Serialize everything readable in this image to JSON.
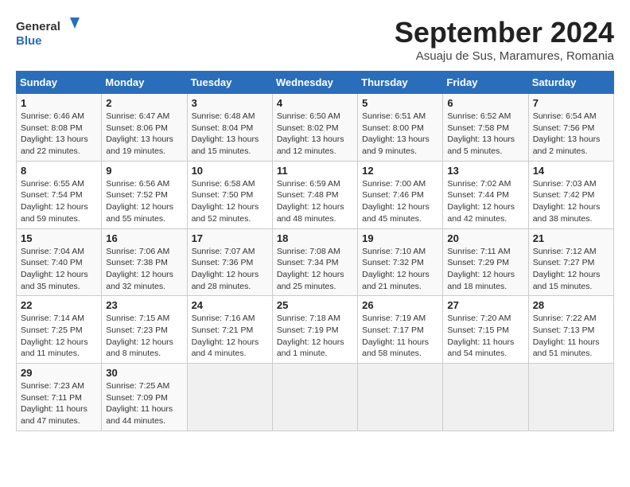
{
  "header": {
    "logo_line1": "General",
    "logo_line2": "Blue",
    "month": "September 2024",
    "location": "Asuaju de Sus, Maramures, Romania"
  },
  "columns": [
    "Sunday",
    "Monday",
    "Tuesday",
    "Wednesday",
    "Thursday",
    "Friday",
    "Saturday"
  ],
  "weeks": [
    [
      {
        "day": "1",
        "detail": "Sunrise: 6:46 AM\nSunset: 8:08 PM\nDaylight: 13 hours\nand 22 minutes."
      },
      {
        "day": "2",
        "detail": "Sunrise: 6:47 AM\nSunset: 8:06 PM\nDaylight: 13 hours\nand 19 minutes."
      },
      {
        "day": "3",
        "detail": "Sunrise: 6:48 AM\nSunset: 8:04 PM\nDaylight: 13 hours\nand 15 minutes."
      },
      {
        "day": "4",
        "detail": "Sunrise: 6:50 AM\nSunset: 8:02 PM\nDaylight: 13 hours\nand 12 minutes."
      },
      {
        "day": "5",
        "detail": "Sunrise: 6:51 AM\nSunset: 8:00 PM\nDaylight: 13 hours\nand 9 minutes."
      },
      {
        "day": "6",
        "detail": "Sunrise: 6:52 AM\nSunset: 7:58 PM\nDaylight: 13 hours\nand 5 minutes."
      },
      {
        "day": "7",
        "detail": "Sunrise: 6:54 AM\nSunset: 7:56 PM\nDaylight: 13 hours\nand 2 minutes."
      }
    ],
    [
      {
        "day": "8",
        "detail": "Sunrise: 6:55 AM\nSunset: 7:54 PM\nDaylight: 12 hours\nand 59 minutes."
      },
      {
        "day": "9",
        "detail": "Sunrise: 6:56 AM\nSunset: 7:52 PM\nDaylight: 12 hours\nand 55 minutes."
      },
      {
        "day": "10",
        "detail": "Sunrise: 6:58 AM\nSunset: 7:50 PM\nDaylight: 12 hours\nand 52 minutes."
      },
      {
        "day": "11",
        "detail": "Sunrise: 6:59 AM\nSunset: 7:48 PM\nDaylight: 12 hours\nand 48 minutes."
      },
      {
        "day": "12",
        "detail": "Sunrise: 7:00 AM\nSunset: 7:46 PM\nDaylight: 12 hours\nand 45 minutes."
      },
      {
        "day": "13",
        "detail": "Sunrise: 7:02 AM\nSunset: 7:44 PM\nDaylight: 12 hours\nand 42 minutes."
      },
      {
        "day": "14",
        "detail": "Sunrise: 7:03 AM\nSunset: 7:42 PM\nDaylight: 12 hours\nand 38 minutes."
      }
    ],
    [
      {
        "day": "15",
        "detail": "Sunrise: 7:04 AM\nSunset: 7:40 PM\nDaylight: 12 hours\nand 35 minutes."
      },
      {
        "day": "16",
        "detail": "Sunrise: 7:06 AM\nSunset: 7:38 PM\nDaylight: 12 hours\nand 32 minutes."
      },
      {
        "day": "17",
        "detail": "Sunrise: 7:07 AM\nSunset: 7:36 PM\nDaylight: 12 hours\nand 28 minutes."
      },
      {
        "day": "18",
        "detail": "Sunrise: 7:08 AM\nSunset: 7:34 PM\nDaylight: 12 hours\nand 25 minutes."
      },
      {
        "day": "19",
        "detail": "Sunrise: 7:10 AM\nSunset: 7:32 PM\nDaylight: 12 hours\nand 21 minutes."
      },
      {
        "day": "20",
        "detail": "Sunrise: 7:11 AM\nSunset: 7:29 PM\nDaylight: 12 hours\nand 18 minutes."
      },
      {
        "day": "21",
        "detail": "Sunrise: 7:12 AM\nSunset: 7:27 PM\nDaylight: 12 hours\nand 15 minutes."
      }
    ],
    [
      {
        "day": "22",
        "detail": "Sunrise: 7:14 AM\nSunset: 7:25 PM\nDaylight: 12 hours\nand 11 minutes."
      },
      {
        "day": "23",
        "detail": "Sunrise: 7:15 AM\nSunset: 7:23 PM\nDaylight: 12 hours\nand 8 minutes."
      },
      {
        "day": "24",
        "detail": "Sunrise: 7:16 AM\nSunset: 7:21 PM\nDaylight: 12 hours\nand 4 minutes."
      },
      {
        "day": "25",
        "detail": "Sunrise: 7:18 AM\nSunset: 7:19 PM\nDaylight: 12 hours\nand 1 minute."
      },
      {
        "day": "26",
        "detail": "Sunrise: 7:19 AM\nSunset: 7:17 PM\nDaylight: 11 hours\nand 58 minutes."
      },
      {
        "day": "27",
        "detail": "Sunrise: 7:20 AM\nSunset: 7:15 PM\nDaylight: 11 hours\nand 54 minutes."
      },
      {
        "day": "28",
        "detail": "Sunrise: 7:22 AM\nSunset: 7:13 PM\nDaylight: 11 hours\nand 51 minutes."
      }
    ],
    [
      {
        "day": "29",
        "detail": "Sunrise: 7:23 AM\nSunset: 7:11 PM\nDaylight: 11 hours\nand 47 minutes."
      },
      {
        "day": "30",
        "detail": "Sunrise: 7:25 AM\nSunset: 7:09 PM\nDaylight: 11 hours\nand 44 minutes."
      },
      {
        "day": "",
        "detail": ""
      },
      {
        "day": "",
        "detail": ""
      },
      {
        "day": "",
        "detail": ""
      },
      {
        "day": "",
        "detail": ""
      },
      {
        "day": "",
        "detail": ""
      }
    ]
  ]
}
